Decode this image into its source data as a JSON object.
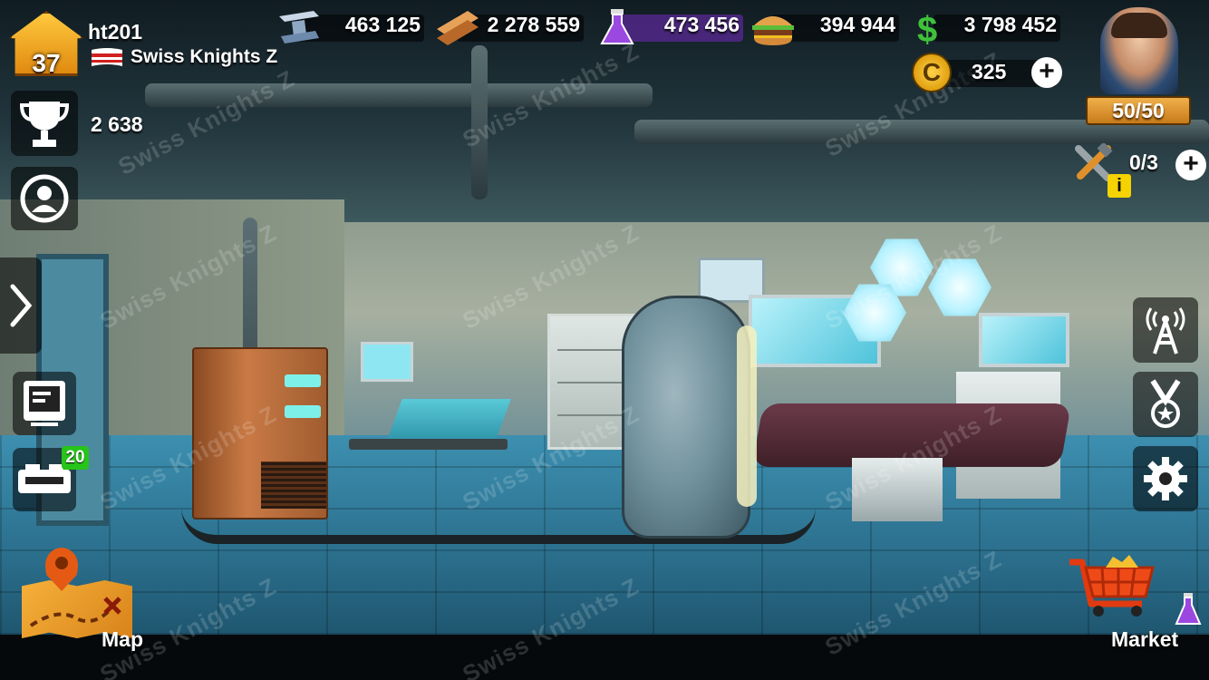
{
  "player": {
    "level": "37",
    "name": "ht201",
    "clan": "Swiss Knights Z",
    "trophies": "2 638"
  },
  "resources": [
    {
      "name": "steel",
      "icon": "steel-beam-icon",
      "value": "463 125",
      "color": "#5b7fa8"
    },
    {
      "name": "wood",
      "icon": "wood-planks-icon",
      "value": "2 278 559",
      "color": "#c7843c"
    },
    {
      "name": "fuel",
      "icon": "flask-icon",
      "value": "473 456",
      "color": "#8a3ad0"
    },
    {
      "name": "food",
      "icon": "burger-icon",
      "value": "394 944",
      "color": "#d89a3a"
    },
    {
      "name": "cash",
      "icon": "dollar-icon",
      "value": "3 798 452",
      "color": "#3aa83a"
    }
  ],
  "coins": {
    "value": "325",
    "symbol": "C"
  },
  "energy": "50/50",
  "builders": {
    "value": "0/3",
    "info": "i"
  },
  "left_menu": {
    "units_badge": "20"
  },
  "buttons": {
    "map_label": "Map",
    "market_label": "Market"
  },
  "watermark": "Swiss Knights Z",
  "colors": {
    "hud_panel": "#000000",
    "energy_bar": "#e09a32",
    "badge_green": "#27c41a",
    "coin_gold": "#ffc83d"
  }
}
